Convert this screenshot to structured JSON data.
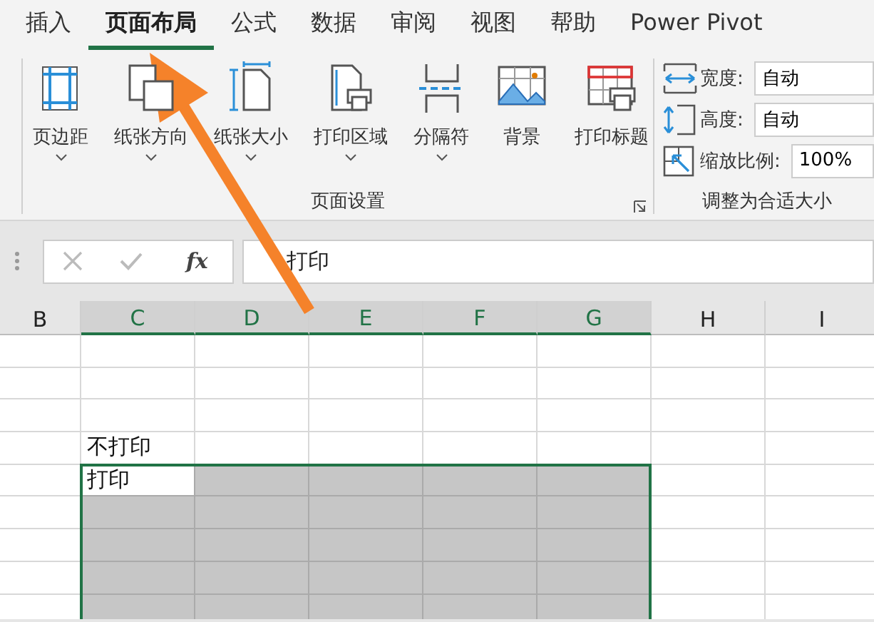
{
  "tabs": [
    {
      "label": "插入",
      "selected": false
    },
    {
      "label": "页面布局",
      "selected": true
    },
    {
      "label": "公式",
      "selected": false
    },
    {
      "label": "数据",
      "selected": false
    },
    {
      "label": "审阅",
      "selected": false
    },
    {
      "label": "视图",
      "selected": false
    },
    {
      "label": "帮助",
      "selected": false
    },
    {
      "label": "Power Pivot",
      "selected": false
    }
  ],
  "page_setup": {
    "label": "页面设置",
    "buttons": [
      {
        "label": "页边距",
        "has_dropdown": true
      },
      {
        "label": "纸张方向",
        "has_dropdown": true
      },
      {
        "label": "纸张大小",
        "has_dropdown": true
      },
      {
        "label": "打印区域",
        "has_dropdown": true
      },
      {
        "label": "分隔符",
        "has_dropdown": true
      },
      {
        "label": "背景",
        "has_dropdown": false
      },
      {
        "label": "打印标题",
        "has_dropdown": false
      }
    ]
  },
  "scale_to_fit": {
    "label": "调整为合适大小",
    "fields": [
      {
        "label": "宽度:",
        "value": "自动"
      },
      {
        "label": "高度:",
        "value": "自动"
      },
      {
        "label": "缩放比例:",
        "value": "100%"
      }
    ]
  },
  "formula_bar": {
    "function_label": "fx",
    "value": "打印"
  },
  "columns": [
    {
      "label": "B",
      "selected": false
    },
    {
      "label": "C",
      "selected": true
    },
    {
      "label": "D",
      "selected": true
    },
    {
      "label": "E",
      "selected": true
    },
    {
      "label": "F",
      "selected": true
    },
    {
      "label": "G",
      "selected": true
    },
    {
      "label": "H",
      "selected": false
    },
    {
      "label": "I",
      "selected": false
    }
  ],
  "rows": [
    {
      "cells": [
        {
          "selected": false
        },
        {
          "selected": false
        },
        {
          "selected": false
        },
        {
          "selected": false
        },
        {
          "selected": false
        },
        {
          "selected": false
        },
        {
          "selected": false
        },
        {
          "selected": false
        }
      ]
    },
    {
      "cells": [
        {
          "selected": false
        },
        {
          "selected": false
        },
        {
          "selected": false
        },
        {
          "selected": false
        },
        {
          "selected": false
        },
        {
          "selected": false
        },
        {
          "selected": false
        },
        {
          "selected": false
        }
      ]
    },
    {
      "cells": [
        {
          "selected": false
        },
        {
          "selected": false
        },
        {
          "selected": false
        },
        {
          "selected": false
        },
        {
          "selected": false
        },
        {
          "selected": false
        },
        {
          "selected": false
        },
        {
          "selected": false
        }
      ]
    },
    {
      "cells": [
        {
          "selected": false
        },
        {
          "selected": false,
          "text": "不打印"
        },
        {
          "selected": false
        },
        {
          "selected": false
        },
        {
          "selected": false
        },
        {
          "selected": false
        },
        {
          "selected": false
        },
        {
          "selected": false
        }
      ]
    },
    {
      "cells": [
        {
          "selected": false
        },
        {
          "selected": true,
          "active": true,
          "text": "打印"
        },
        {
          "selected": true
        },
        {
          "selected": true
        },
        {
          "selected": true
        },
        {
          "selected": true
        },
        {
          "selected": false
        },
        {
          "selected": false
        }
      ]
    },
    {
      "cells": [
        {
          "selected": false
        },
        {
          "selected": true
        },
        {
          "selected": true
        },
        {
          "selected": true
        },
        {
          "selected": true
        },
        {
          "selected": true
        },
        {
          "selected": false
        },
        {
          "selected": false
        }
      ]
    },
    {
      "cells": [
        {
          "selected": false
        },
        {
          "selected": true
        },
        {
          "selected": true
        },
        {
          "selected": true
        },
        {
          "selected": true
        },
        {
          "selected": true
        },
        {
          "selected": false
        },
        {
          "selected": false
        }
      ]
    },
    {
      "cells": [
        {
          "selected": false
        },
        {
          "selected": true
        },
        {
          "selected": true
        },
        {
          "selected": true
        },
        {
          "selected": true
        },
        {
          "selected": true
        },
        {
          "selected": false
        },
        {
          "selected": false
        }
      ]
    },
    {
      "cells": [
        {
          "selected": false
        },
        {
          "selected": true
        },
        {
          "selected": true
        },
        {
          "selected": true
        },
        {
          "selected": true
        },
        {
          "selected": true
        },
        {
          "selected": false
        },
        {
          "selected": false
        }
      ]
    }
  ]
}
